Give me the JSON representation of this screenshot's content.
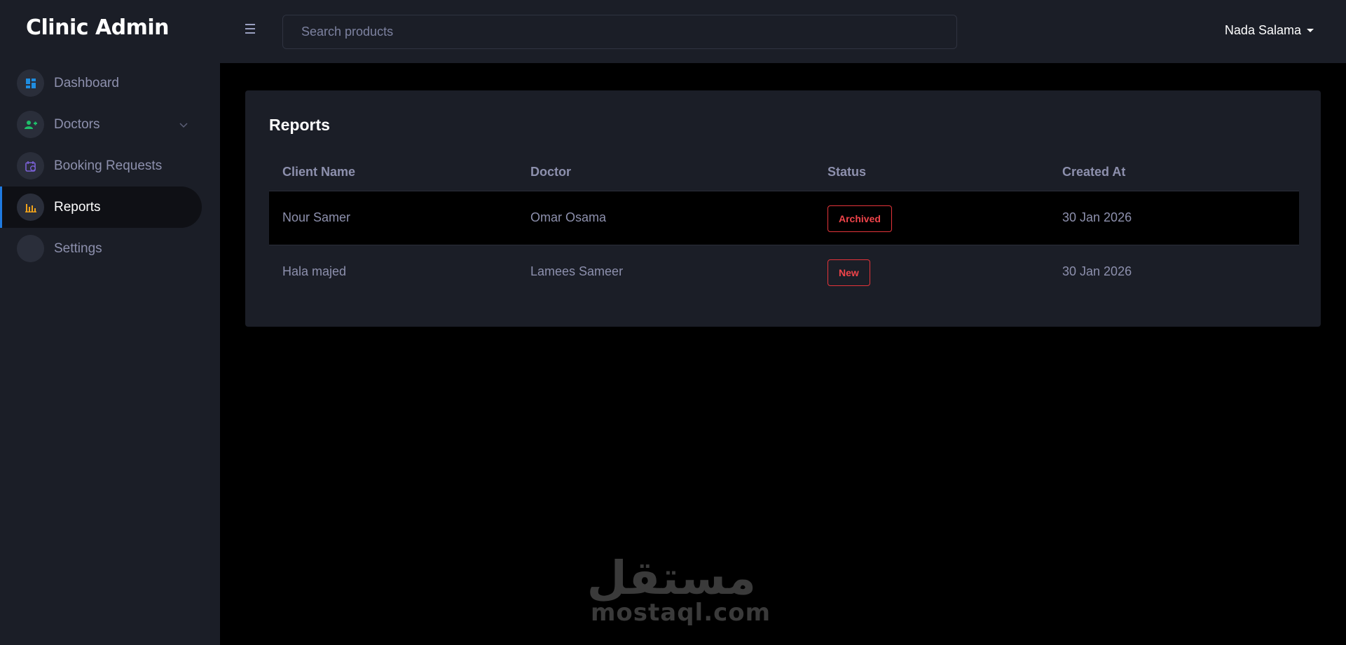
{
  "app": {
    "title": "Clinic Admin"
  },
  "sidebar": {
    "items": [
      {
        "label": "Dashboard",
        "icon": "dashboard-icon",
        "color": "#1f8de0"
      },
      {
        "label": "Doctors",
        "icon": "doctors-icon",
        "color": "#1fbf6a"
      },
      {
        "label": "Booking Requests",
        "icon": "calendar-icon",
        "color": "#7b61d6"
      },
      {
        "label": "Reports",
        "icon": "bar-chart-icon",
        "color": "#f0a21a"
      },
      {
        "label": "Settings",
        "icon": "",
        "color": ""
      }
    ],
    "active": "Reports"
  },
  "topbar": {
    "search_placeholder": "Search products",
    "user_name": "Nada Salama"
  },
  "reports": {
    "title": "Reports",
    "columns": [
      "Client Name",
      "Doctor",
      "Status",
      "Created At"
    ],
    "rows": [
      {
        "client": "Nour Samer",
        "doctor": "Omar Osama",
        "status": "Archived",
        "created": "30 Jan 2026"
      },
      {
        "client": "Hala majed",
        "doctor": "Lamees Sameer",
        "status": "New",
        "created": "30 Jan 2026"
      }
    ]
  },
  "watermark": {
    "arabic": "مستقل",
    "latin": "mostaql.com"
  },
  "colors": {
    "accent": "#1f7ae0",
    "badge_red": "#e5343a",
    "panel": "#1b1e27"
  }
}
